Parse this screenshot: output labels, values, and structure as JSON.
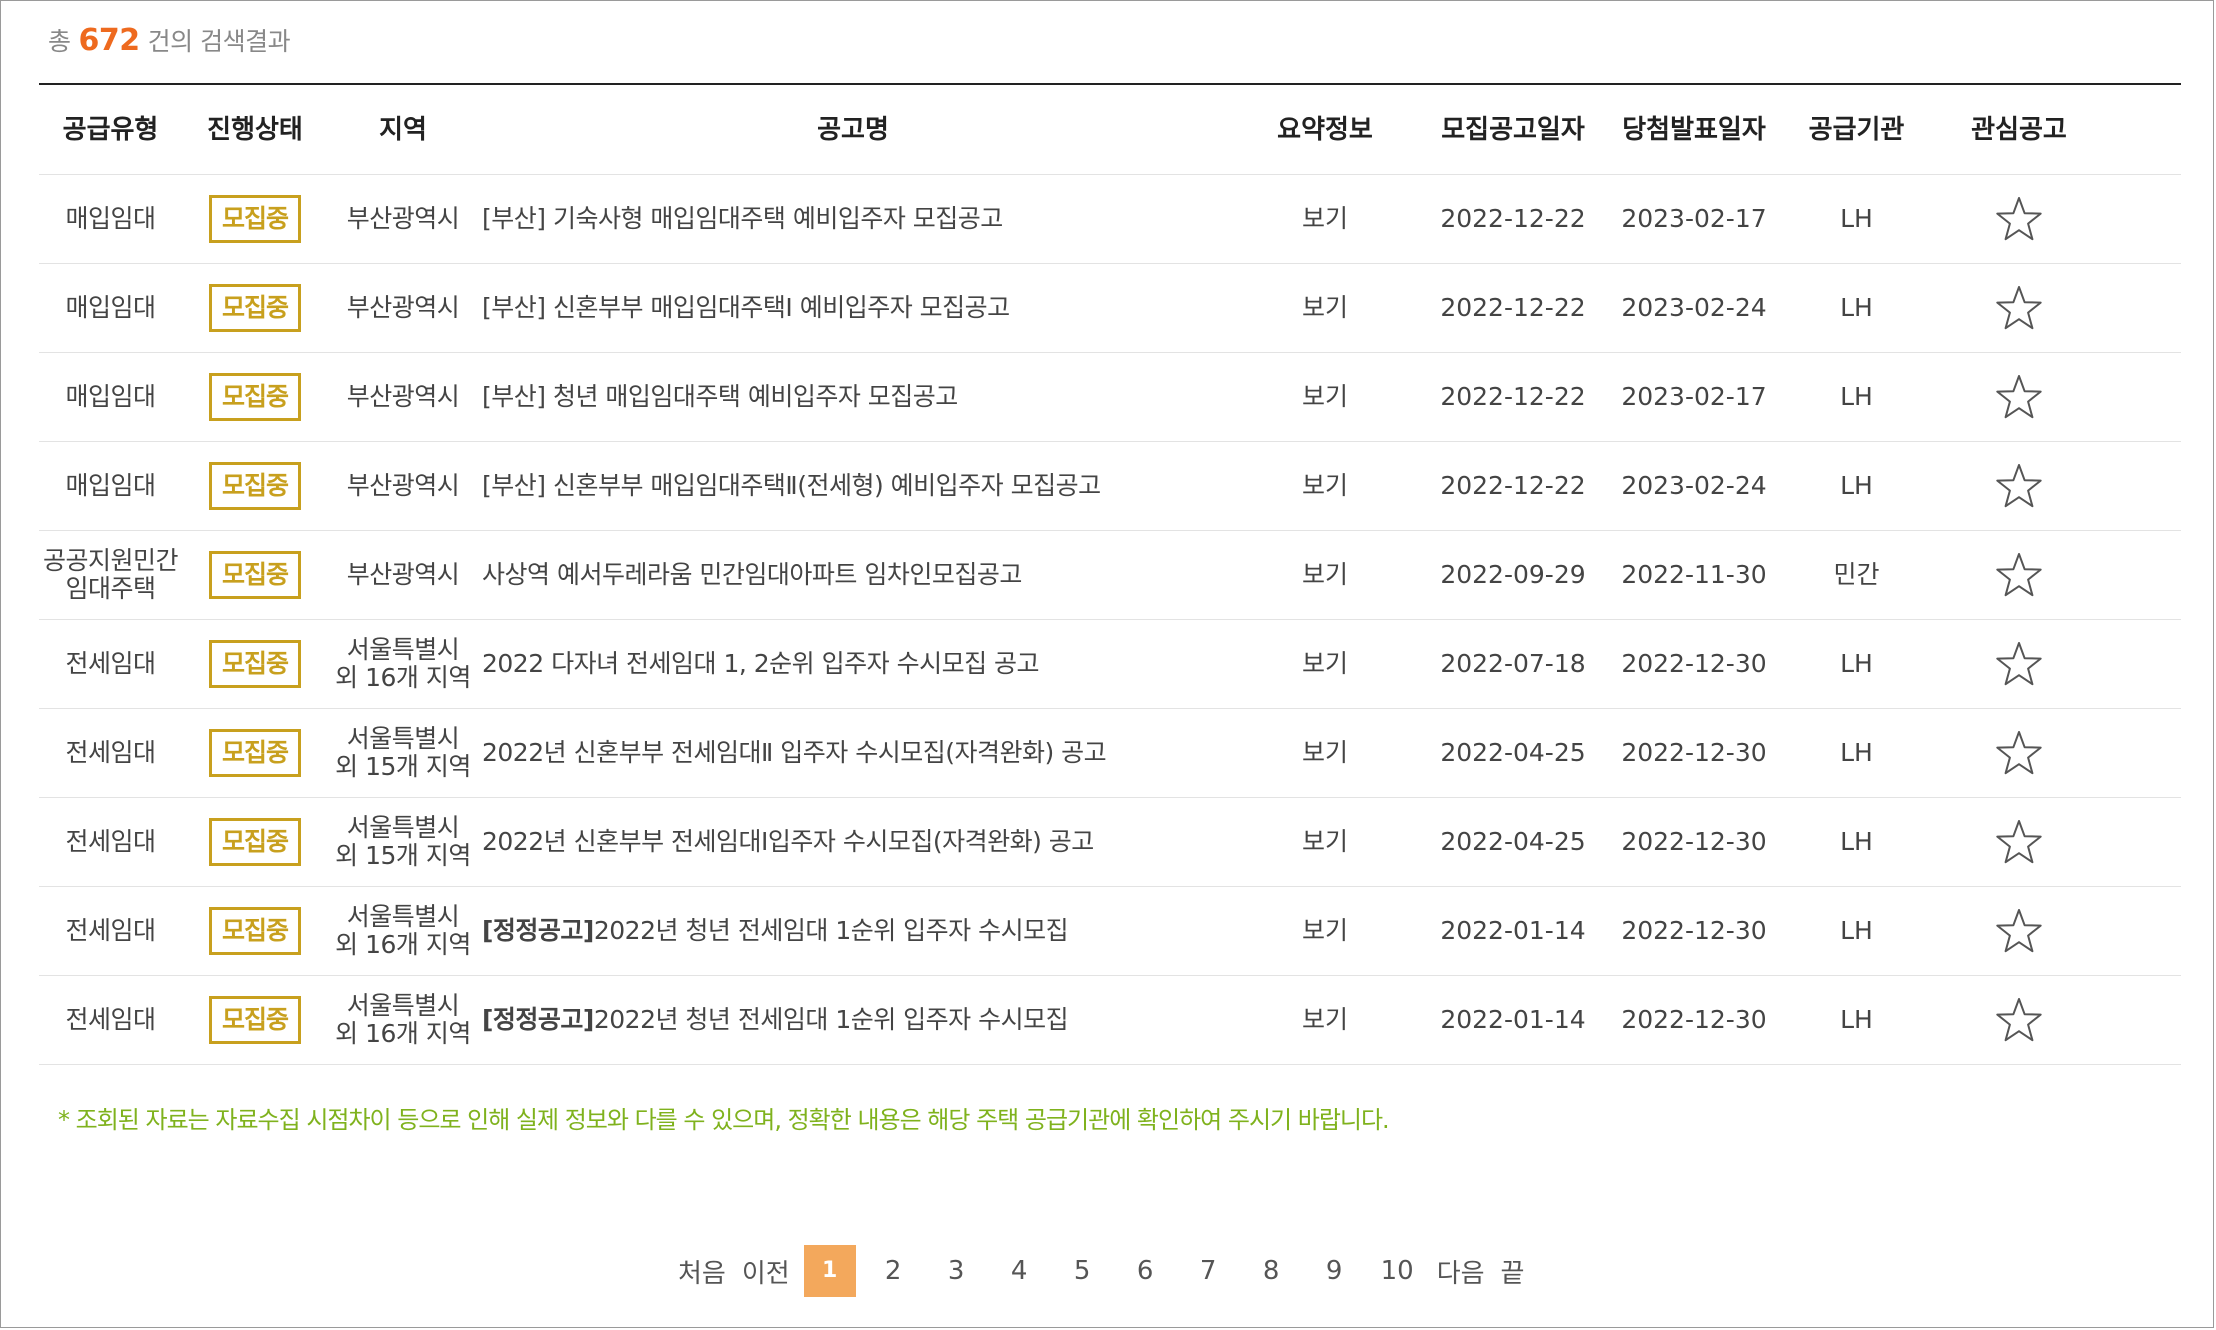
{
  "summary": {
    "prefix": "총",
    "count": "672",
    "suffix": "건의 검색결과"
  },
  "columns": {
    "type": "공급유형",
    "status": "진행상태",
    "region": "지역",
    "title": "공고명",
    "summary": "요약정보",
    "recruit_date": "모집공고일자",
    "winner_date": "당첨발표일자",
    "agency": "공급기관",
    "favorite": "관심공고"
  },
  "rows": [
    {
      "type": "매입임대",
      "status": "모집중",
      "region": "부산광역시",
      "tag": "",
      "title": "[부산] 기숙사형 매입임대주택 예비입주자 모집공고",
      "summary": "보기",
      "recruit_date": "2022-12-22",
      "winner_date": "2023-02-17",
      "agency": "LH"
    },
    {
      "type": "매입임대",
      "status": "모집중",
      "region": "부산광역시",
      "tag": "",
      "title": "[부산] 신혼부부 매입임대주택Ⅰ 예비입주자 모집공고",
      "summary": "보기",
      "recruit_date": "2022-12-22",
      "winner_date": "2023-02-24",
      "agency": "LH"
    },
    {
      "type": "매입임대",
      "status": "모집중",
      "region": "부산광역시",
      "tag": "",
      "title": "[부산] 청년 매입임대주택 예비입주자 모집공고",
      "summary": "보기",
      "recruit_date": "2022-12-22",
      "winner_date": "2023-02-17",
      "agency": "LH"
    },
    {
      "type": "매입임대",
      "status": "모집중",
      "region": "부산광역시",
      "tag": "",
      "title": "[부산] 신혼부부 매입임대주택Ⅱ(전세형) 예비입주자 모집공고",
      "summary": "보기",
      "recruit_date": "2022-12-22",
      "winner_date": "2023-02-24",
      "agency": "LH"
    },
    {
      "type": "공공지원민간\n임대주택",
      "status": "모집중",
      "region": "부산광역시",
      "tag": "",
      "title": "사상역 예서두레라움 민간임대아파트 임차인모집공고",
      "summary": "보기",
      "recruit_date": "2022-09-29",
      "winner_date": "2022-11-30",
      "agency": "민간"
    },
    {
      "type": "전세임대",
      "status": "모집중",
      "region": "서울특별시\n외 16개 지역",
      "tag": "",
      "title": "2022 다자녀 전세임대 1, 2순위 입주자 수시모집 공고",
      "summary": "보기",
      "recruit_date": "2022-07-18",
      "winner_date": "2022-12-30",
      "agency": "LH"
    },
    {
      "type": "전세임대",
      "status": "모집중",
      "region": "서울특별시\n외 15개 지역",
      "tag": "",
      "title": "2022년 신혼부부 전세임대Ⅱ 입주자 수시모집(자격완화) 공고",
      "summary": "보기",
      "recruit_date": "2022-04-25",
      "winner_date": "2022-12-30",
      "agency": "LH"
    },
    {
      "type": "전세임대",
      "status": "모집중",
      "region": "서울특별시\n외 15개 지역",
      "tag": "",
      "title": "2022년 신혼부부 전세임대Ⅰ입주자 수시모집(자격완화) 공고",
      "summary": "보기",
      "recruit_date": "2022-04-25",
      "winner_date": "2022-12-30",
      "agency": "LH"
    },
    {
      "type": "전세임대",
      "status": "모집중",
      "region": "서울특별시\n외 16개 지역",
      "tag": "[정정공고]",
      "title": "2022년 청년 전세임대 1순위 입주자 수시모집",
      "summary": "보기",
      "recruit_date": "2022-01-14",
      "winner_date": "2022-12-30",
      "agency": "LH"
    },
    {
      "type": "전세임대",
      "status": "모집중",
      "region": "서울특별시\n외 16개 지역",
      "tag": "[정정공고]",
      "title": "2022년 청년 전세임대 1순위 입주자 수시모집",
      "summary": "보기",
      "recruit_date": "2022-01-14",
      "winner_date": "2022-12-30",
      "agency": "LH"
    }
  ],
  "note": "* 조회된 자료는 자료수집 시점차이 등으로 인해 실제 정보와 다를 수 있으며, 정확한 내용은 해당 주택 공급기관에 확인하여 주시기 바랍니다.",
  "pagination": {
    "first": "처음",
    "prev": "이전",
    "pages": [
      "1",
      "2",
      "3",
      "4",
      "5",
      "6",
      "7",
      "8",
      "9",
      "10"
    ],
    "current": "1",
    "next": "다음",
    "last": "끝"
  },
  "colors": {
    "accent": "#ee6a1f",
    "badge": "#c8a01e",
    "note": "#7fb21d",
    "page_active": "#f3a85c"
  },
  "icons": {
    "favorite": "star-outline-icon"
  }
}
